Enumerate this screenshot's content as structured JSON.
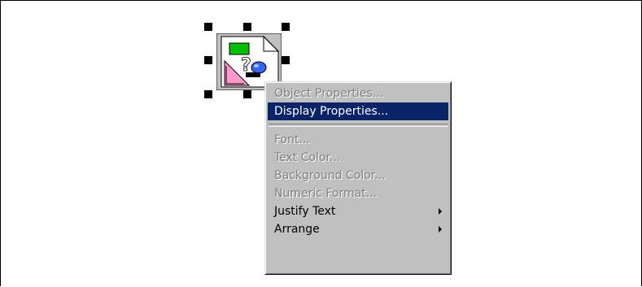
{
  "context_menu": {
    "items": [
      {
        "label": "Object Properties...",
        "state": "disabled"
      },
      {
        "label": "Display Properties...",
        "state": "highlighted"
      },
      {
        "label": "Font...",
        "state": "disabled"
      },
      {
        "label": "Text Color...",
        "state": "disabled"
      },
      {
        "label": "Background Color...",
        "state": "disabled"
      },
      {
        "label": "Numeric Format...",
        "state": "disabled"
      },
      {
        "label": "Justify Text",
        "state": "enabled",
        "has_submenu": true
      },
      {
        "label": "Arrange",
        "state": "enabled",
        "has_submenu": true
      }
    ]
  },
  "embedded_object": {
    "icon": "unknown-object-icon",
    "selected": true
  },
  "colors": {
    "menu_background": "#c0c0c0",
    "highlight": "#0a246a",
    "disabled_text": "#808080"
  }
}
